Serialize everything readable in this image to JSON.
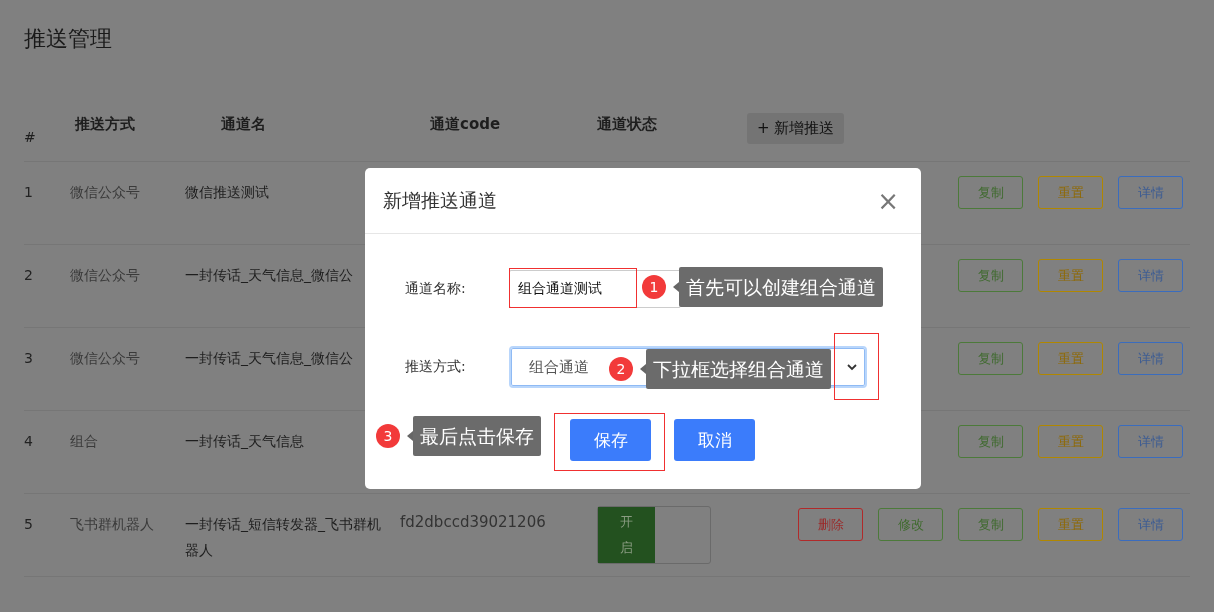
{
  "page": {
    "title": "推送管理"
  },
  "table": {
    "columns": [
      "#",
      "推送方式",
      "通道名",
      "通道code",
      "通道状态"
    ],
    "add_button": "+ 新增推送",
    "rows": [
      {
        "index": "1",
        "method": "微信公众号",
        "name": "微信推送测试",
        "actions": [
          {
            "label": "复制",
            "kind": "copy"
          },
          {
            "label": "重置",
            "kind": "reset"
          },
          {
            "label": "详情",
            "kind": "detail"
          }
        ]
      },
      {
        "index": "2",
        "method": "微信公众号",
        "name": "一封传话_天气信息_微信公",
        "actions": [
          {
            "label": "复制",
            "kind": "copy"
          },
          {
            "label": "重置",
            "kind": "reset"
          },
          {
            "label": "详情",
            "kind": "detail"
          }
        ]
      },
      {
        "index": "3",
        "method": "微信公众号",
        "name": "一封传话_天气信息_微信公",
        "actions": [
          {
            "label": "复制",
            "kind": "copy"
          },
          {
            "label": "重置",
            "kind": "reset"
          },
          {
            "label": "详情",
            "kind": "detail"
          }
        ]
      },
      {
        "index": "4",
        "method": "组合",
        "name": "一封传话_天气信息",
        "actions": [
          {
            "label": "复制",
            "kind": "copy"
          },
          {
            "label": "重置",
            "kind": "reset"
          },
          {
            "label": "详情",
            "kind": "detail"
          }
        ]
      },
      {
        "index": "5",
        "method": "飞书群机器人",
        "name": "一封传话_短信转发器_飞书群机器人",
        "code": "fd2dbccd39021206",
        "status": {
          "label": "开启",
          "on": true
        },
        "actions": [
          {
            "label": "删除",
            "kind": "delete"
          },
          {
            "label": "修改",
            "kind": "edit"
          },
          {
            "label": "复制",
            "kind": "copy"
          },
          {
            "label": "重置",
            "kind": "reset"
          },
          {
            "label": "详情",
            "kind": "detail"
          }
        ]
      }
    ]
  },
  "dialog": {
    "title": "新增推送通道",
    "close": "×",
    "fields": [
      {
        "label": "通道名称:",
        "kind": "text",
        "value": "组合通道测试",
        "focused": false
      },
      {
        "label": "推送方式:",
        "kind": "select",
        "value": "组合通道",
        "focused": true
      }
    ],
    "buttons": [
      {
        "label": "保存",
        "kind": "primary"
      },
      {
        "label": "取消",
        "kind": "primary"
      }
    ]
  },
  "annotations": [
    {
      "number": "1",
      "text": "首先可以创建组合通道"
    },
    {
      "number": "2",
      "text": "下拉框选择组合通道"
    },
    {
      "number": "3",
      "text": "最后点击保存"
    }
  ]
}
